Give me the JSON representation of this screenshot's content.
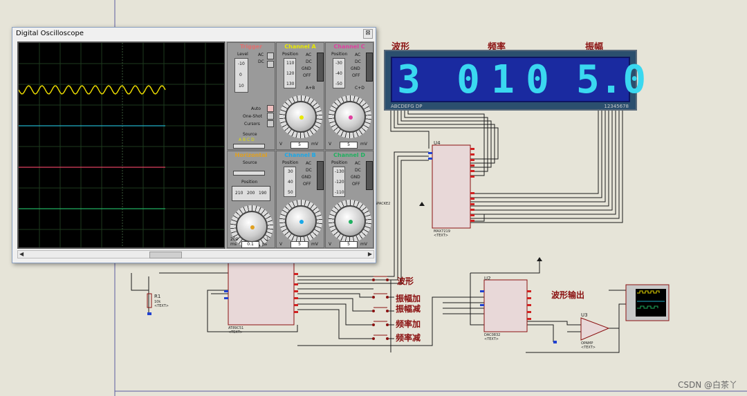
{
  "oscilloscope": {
    "title": "Digital Oscilloscope",
    "close_glyph": "⊠",
    "trigger": {
      "header": "Trigger",
      "level_label": "Level",
      "ac": "AC",
      "dc": "DC",
      "auto": "Auto",
      "one_shot": "One-Shot",
      "cursors": "Cursors",
      "source_label": "Source",
      "source_opts": "A B C D",
      "scale": [
        "-10",
        "0",
        "10"
      ]
    },
    "horizontal": {
      "header": "Horizontal",
      "source_label": "Source",
      "position_label": "Position",
      "position_vals": [
        "210",
        "200",
        "190"
      ],
      "time_unit": "ms",
      "time_val": "0.1",
      "time_unit2": "μs",
      "scale_vals": [
        "200",
        "1"
      ]
    },
    "channel_a": {
      "header": "Channel A",
      "color": "#e8e800",
      "position_label": "Position",
      "ac": "AC",
      "dc": "DC",
      "gnd": "GND",
      "off": "OFF",
      "pos_vals": [
        "110",
        "120",
        "130"
      ],
      "combine": "A+B",
      "v_unit": "V",
      "mv_unit": "mV",
      "val": "5"
    },
    "channel_b": {
      "header": "Channel B",
      "color": "#1aa8e8",
      "position_label": "Position",
      "ac": "AC",
      "dc": "DC",
      "gnd": "GND",
      "off": "OFF",
      "pos_vals": [
        "30",
        "40",
        "50"
      ],
      "v_unit": "V",
      "mv_unit": "mV",
      "val": "5"
    },
    "channel_c": {
      "header": "Channel C",
      "color": "#e040a0",
      "position_label": "Position",
      "ac": "AC",
      "dc": "DC",
      "gnd": "GND",
      "off": "OFF",
      "pos_vals": [
        "-30",
        "-40",
        "-50"
      ],
      "combine": "C+D",
      "v_unit": "V",
      "mv_unit": "mV",
      "val": "5"
    },
    "channel_d": {
      "header": "Channel D",
      "color": "#20b060",
      "position_label": "Position",
      "ac": "AC",
      "dc": "DC",
      "gnd": "GND",
      "off": "OFF",
      "pos_vals": [
        "-130",
        "-120",
        "-110"
      ],
      "v_unit": "V",
      "mv_unit": "mV",
      "val": "5"
    },
    "traces": [
      "#e8d800",
      "#20b0c8",
      "#e04060",
      "#20b060"
    ]
  },
  "display": {
    "labels": [
      "波形",
      "频率",
      "振幅"
    ],
    "digits": [
      "3",
      "0",
      "1",
      "0",
      "5.0"
    ],
    "pins_left": "ABCDEFG  DP",
    "pins_right": "12345678"
  },
  "schematic": {
    "buttons": [
      "波形",
      "振幅加",
      "振幅减",
      "频率加",
      "频率减"
    ],
    "output_label": "波形输出",
    "u4": {
      "ref": "U4",
      "part": "MAX7219",
      "text": "<TEXT>"
    },
    "u2": {
      "ref": "U2",
      "part": "DAC0832",
      "text": "<TEXT>"
    },
    "u3": {
      "ref": "U3",
      "part": "OPAMP",
      "text": "<TEXT>"
    },
    "u1": {
      "part": "AT89C51",
      "text": "<TEXT>"
    },
    "r1": {
      "ref": "R1",
      "value": "10k",
      "text": "<TEXT>"
    },
    "spackage": "SPACKE2"
  },
  "watermark": "CSDN @白茶丫"
}
